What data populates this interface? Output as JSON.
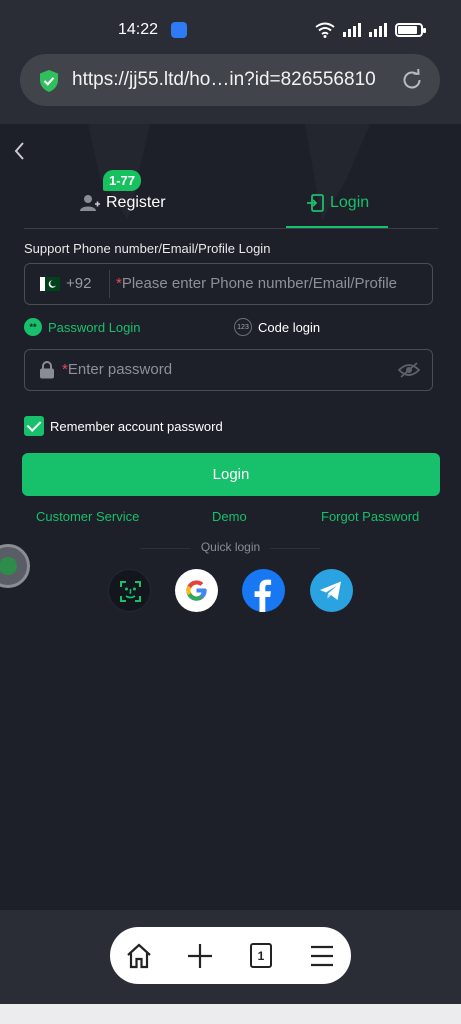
{
  "status_bar": {
    "time": "14:22"
  },
  "browser": {
    "url": "https://jj55.ltd/ho…in?id=826556810"
  },
  "tabs": {
    "register_label": "Register",
    "register_badge": "1-77",
    "login_label": "Login"
  },
  "form": {
    "support_label": "Support Phone number/Email/Profile Login",
    "country_code": "+92",
    "required_mark": "*",
    "phone_placeholder": "Please enter Phone number/Email/Profile",
    "password_placeholder": "Enter password",
    "method_password": "Password Login",
    "method_password_icon_text": "**",
    "method_code": "Code login",
    "method_code_icon_text": "123",
    "remember_label": "Remember account password",
    "remember_checked": true,
    "login_button": "Login"
  },
  "links": {
    "customer_service": "Customer Service",
    "demo": "Demo",
    "forgot_password": "Forgot Password"
  },
  "quick_login": {
    "label": "Quick login",
    "providers": [
      "face-id-icon",
      "google-icon",
      "facebook-icon",
      "telegram-icon"
    ]
  },
  "bottom_nav": {
    "tab_count": "1",
    "items": [
      "home-icon",
      "plus-icon",
      "tabs-icon",
      "menu-icon"
    ]
  },
  "colors": {
    "accent": "#17c06a",
    "background": "#1d1f29",
    "required": "#e64a5a"
  }
}
